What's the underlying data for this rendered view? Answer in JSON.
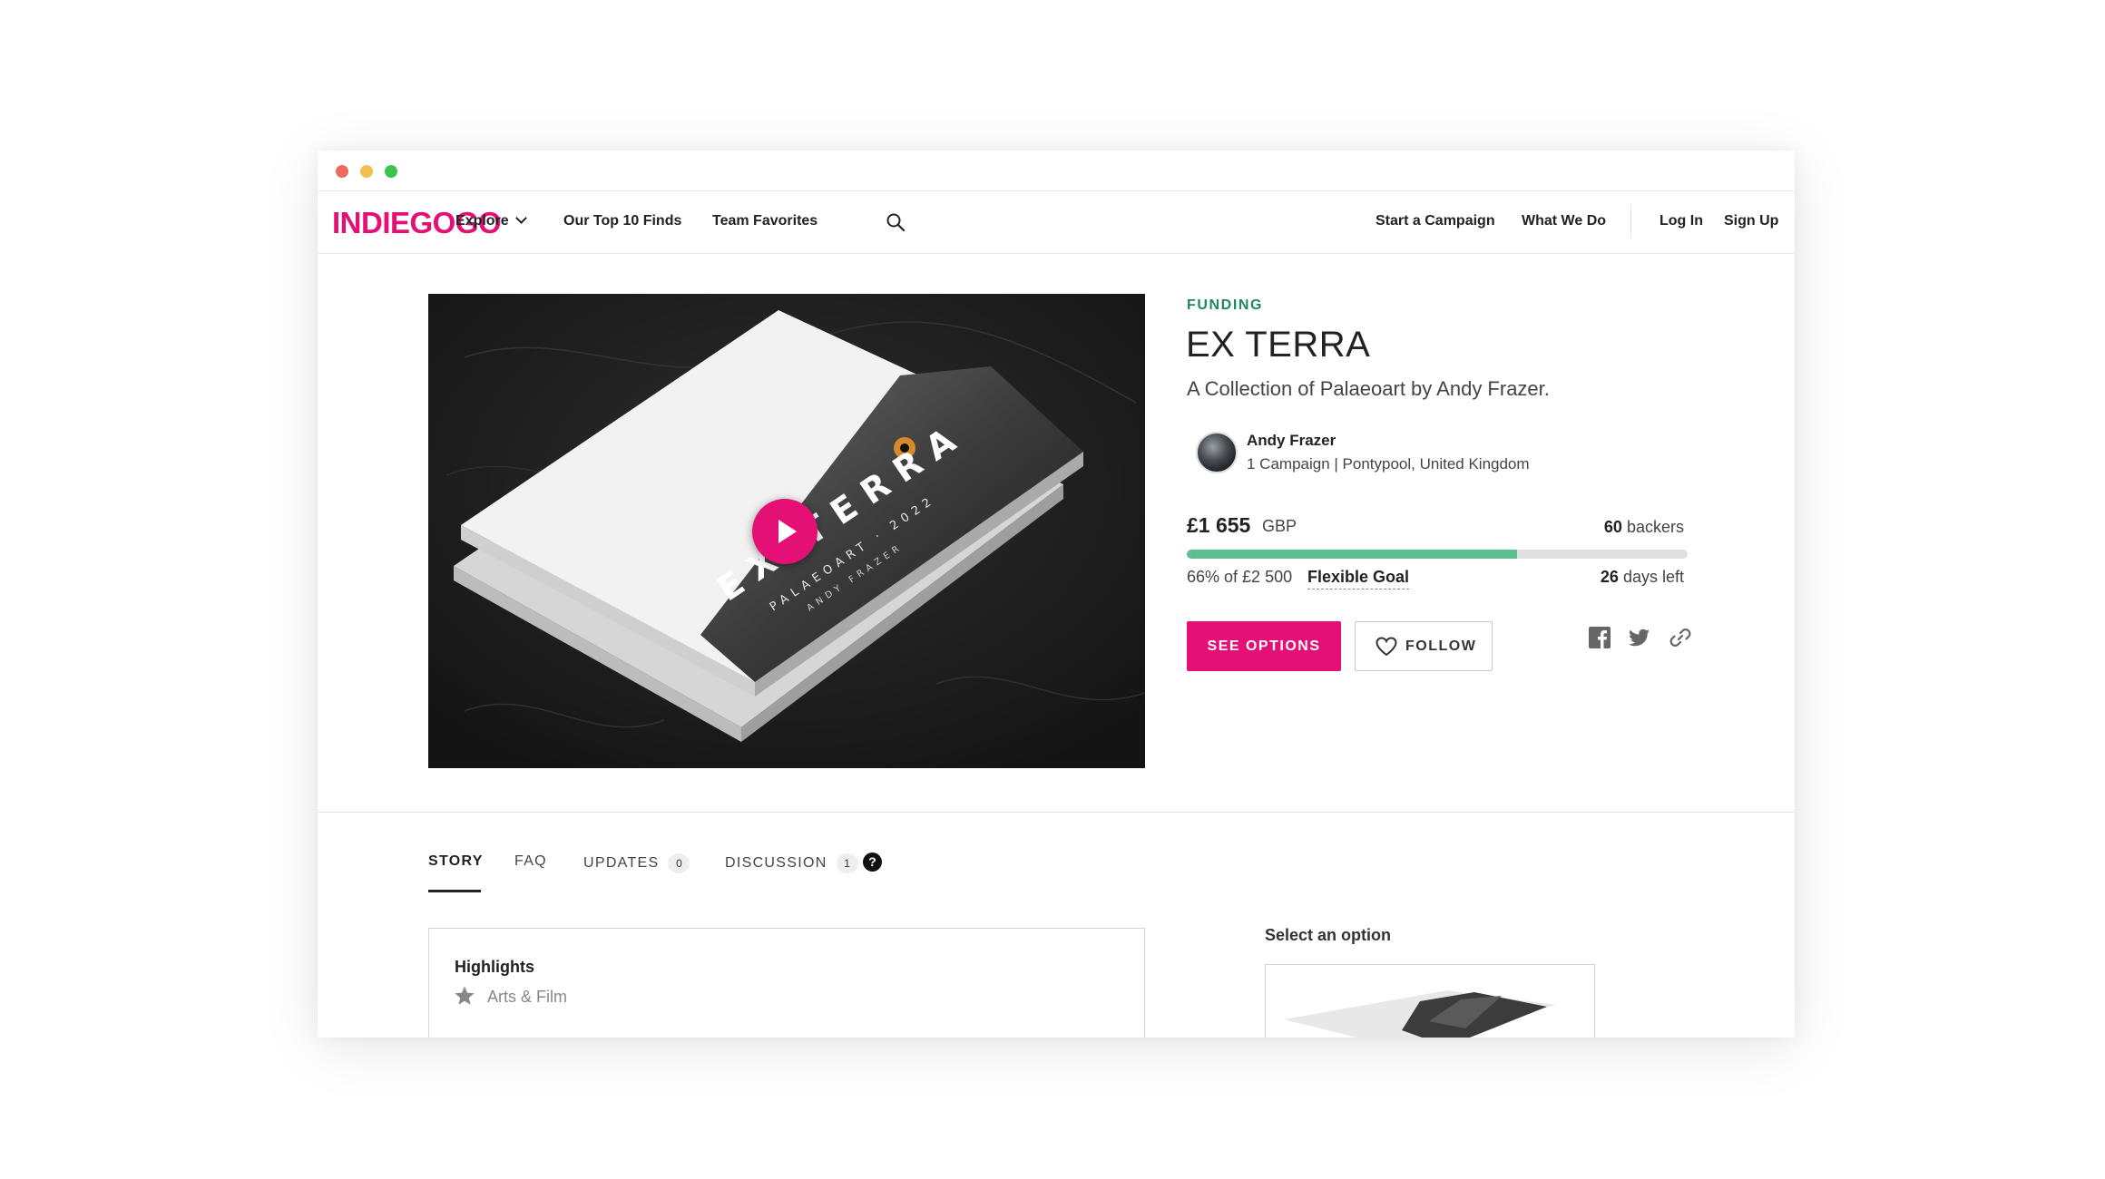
{
  "nav": {
    "logo": "INDIEGOGO",
    "explore": "Explore",
    "top10": "Our Top 10 Finds",
    "team_favorites": "Team Favorites",
    "start_campaign": "Start a Campaign",
    "what_we_do": "What We Do",
    "log_in": "Log In",
    "sign_up": "Sign Up"
  },
  "hero_image": {
    "cover_text_large": "EX TERRA",
    "cover_text_small": "PALAEOART · 2022",
    "cover_author": "ANDY FRAZER"
  },
  "campaign": {
    "status": "FUNDING",
    "title": "EX TERRA",
    "tagline": "A Collection of Palaeoart by Andy Frazer.",
    "owner_name": "Andy Frazer",
    "owner_meta": "1 Campaign | Pontypool, United Kingdom",
    "raised": "£1 655",
    "currency": "GBP",
    "backers_count": "60",
    "backers_label": "backers",
    "progress_fraction": 0.66,
    "percent_text": "66% of £2 500",
    "goal_type": "Flexible Goal",
    "days_count": "26",
    "days_label": "days left"
  },
  "actions": {
    "see_options": "SEE OPTIONS",
    "follow": "FOLLOW"
  },
  "tabs": {
    "story": "STORY",
    "faq": "FAQ",
    "updates": "UPDATES",
    "updates_count": "0",
    "discussion": "DISCUSSION",
    "discussion_count": "1",
    "help": "?"
  },
  "highlights": {
    "title": "Highlights",
    "category": "Arts & Film"
  },
  "perks": {
    "select_label": "Select an option"
  },
  "colors": {
    "brand": "#e51075",
    "funding_status": "#1d8a5c",
    "progress_fill": "#5ec090"
  }
}
